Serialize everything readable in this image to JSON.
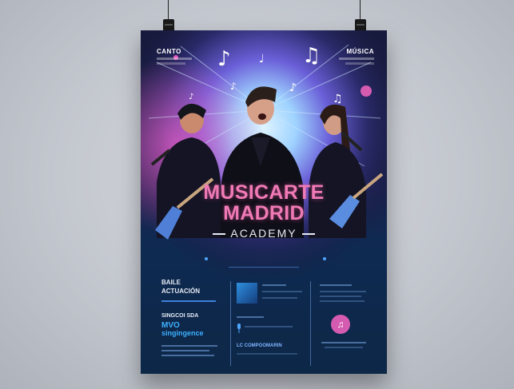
{
  "poster": {
    "corner_left": "CANTO",
    "corner_right": "MÚSICA",
    "title_line1": "MUSICARTE",
    "title_line2": "MADRID",
    "title_line3": "ACADEMY",
    "bottom_left_line1": "BAILE",
    "bottom_left_line2": "ACTUACIÓN",
    "bottom_left_line3": "SINGCOI SDA",
    "neon_text_1": "MVO",
    "neon_text_2": "singingence",
    "middle_bottom_label": "LC COMPOOMARIN"
  },
  "colors": {
    "wall": "#c9cdd3",
    "poster_bg": "#1b1f4a",
    "title_pink": "#f07ab5",
    "accent_blue": "#3f7fd9"
  }
}
